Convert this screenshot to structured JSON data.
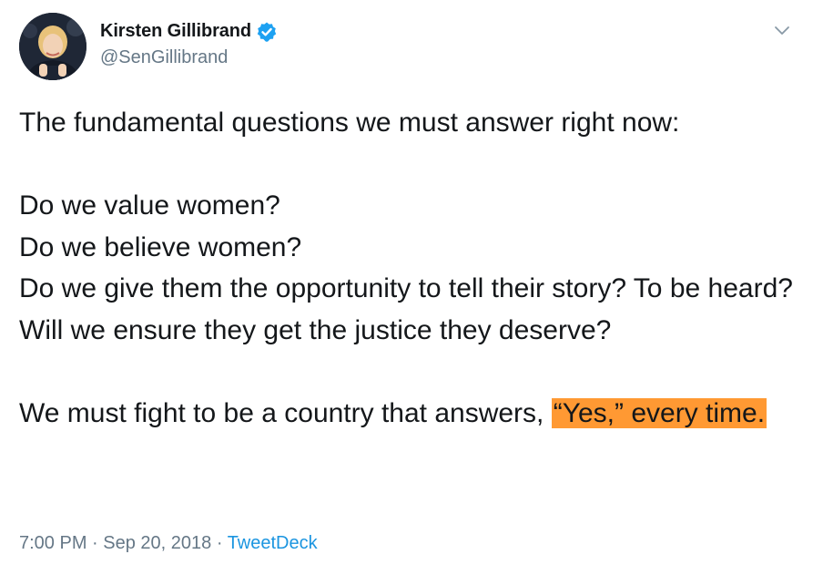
{
  "author": {
    "display_name": "Kirsten Gillibrand",
    "handle": "@SenGillibrand",
    "verified": true
  },
  "tweet": {
    "line_1": "The fundamental questions we must answer right now:",
    "line_2": "Do we value women?",
    "line_3": "Do we believe women?",
    "line_4": "Do we give them the opportunity to tell their story? To be heard?",
    "line_5": "Will we ensure they get the justice they deserve?",
    "closing_plain": "We must fight to be a country that answers, ",
    "closing_highlighted": "“Yes,” every time."
  },
  "meta": {
    "time": "7:00 PM",
    "separator_1": " · ",
    "date": "Sep 20, 2018",
    "separator_2": " · ",
    "source": "TweetDeck"
  },
  "icons": {
    "verified": "verified-badge-icon",
    "caret": "chevron-down-icon"
  },
  "colors": {
    "verified_blue": "#1da1f2",
    "link_blue": "#1b95e0",
    "muted_gray": "#657786",
    "highlight_orange": "#ff9933"
  }
}
